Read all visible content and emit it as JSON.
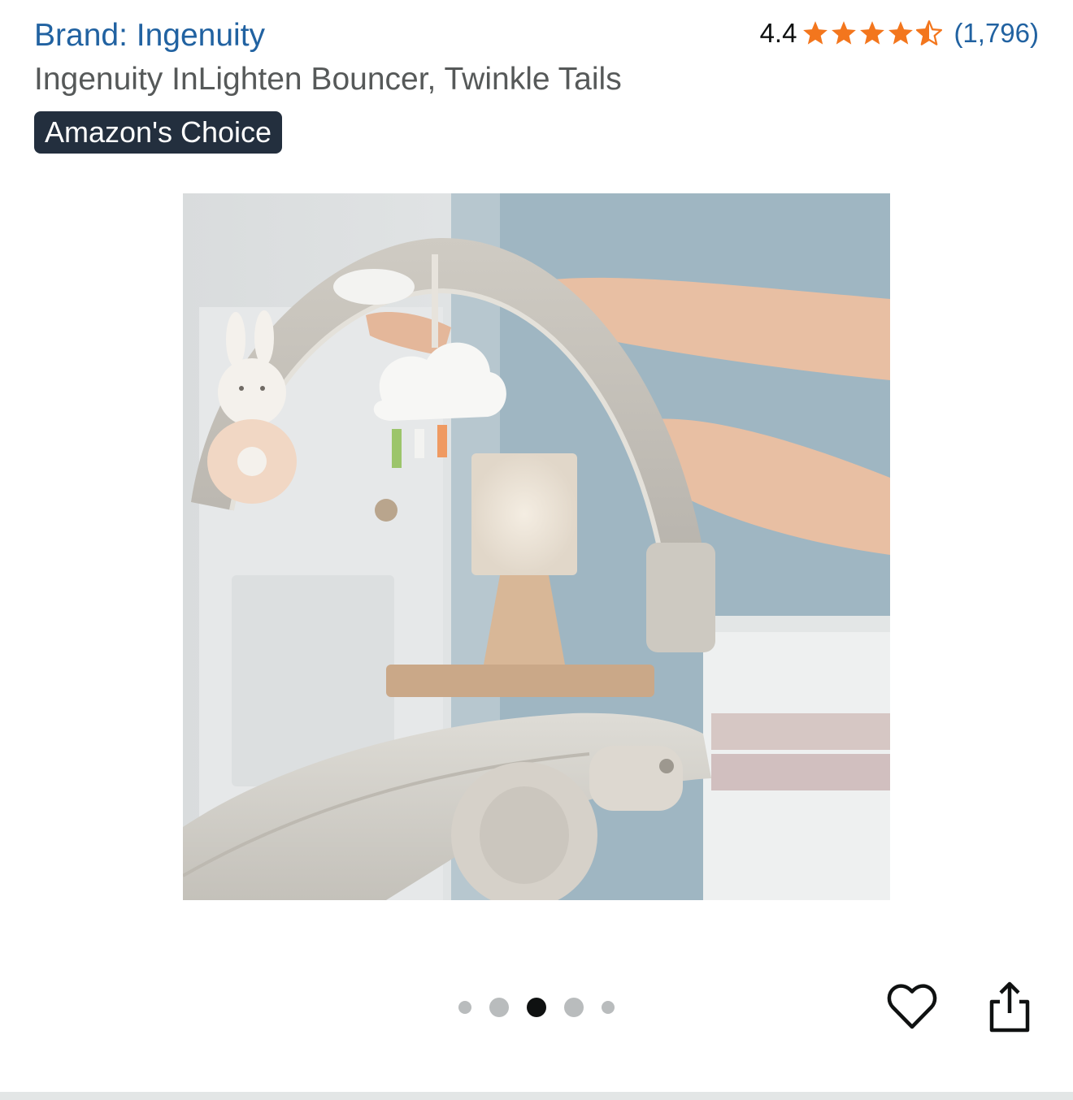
{
  "product": {
    "brand_label": "Brand: Ingenuity",
    "title": "Ingenuity InLighten Bouncer, Twinkle Tails",
    "badge": "Amazon's Choice"
  },
  "rating": {
    "value": "4.4",
    "stars": 4.5,
    "count_label": "(1,796)",
    "star_color": "#F3761D"
  },
  "image": {
    "subject": "bouncer-toy-bar-with-bunny-and-cloud-toys"
  },
  "carousel": {
    "total": 5,
    "active_index": 2
  },
  "actions": {
    "wishlist_icon": "heart-icon",
    "share_icon": "share-icon"
  }
}
